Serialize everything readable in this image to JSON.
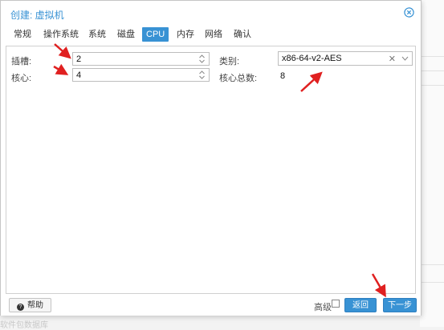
{
  "dialog": {
    "title": "创建: 虚拟机",
    "close_icon": "close-circle-icon"
  },
  "tabs": [
    {
      "label": "常规",
      "active": false
    },
    {
      "label": "操作系统",
      "active": false
    },
    {
      "label": "系统",
      "active": false
    },
    {
      "label": "磁盘",
      "active": false
    },
    {
      "label": "CPU",
      "active": true
    },
    {
      "label": "内存",
      "active": false
    },
    {
      "label": "网络",
      "active": false
    },
    {
      "label": "确认",
      "active": false
    }
  ],
  "cpu": {
    "sockets_label": "插槽:",
    "sockets_value": "2",
    "cores_label": "核心:",
    "cores_value": "4",
    "type_label": "类别:",
    "type_value": "x86-64-v2-AES",
    "total_cores_label": "核心总数:",
    "total_cores_value": "8"
  },
  "footer": {
    "help_label": "帮助",
    "advanced_label": "高级",
    "advanced_checked": false,
    "back_label": "返回",
    "next_label": "下一步"
  },
  "background": {
    "bottom_text": "软件包数据库"
  },
  "colors": {
    "accent": "#3892d4",
    "annotation_arrow": "#e02020"
  }
}
